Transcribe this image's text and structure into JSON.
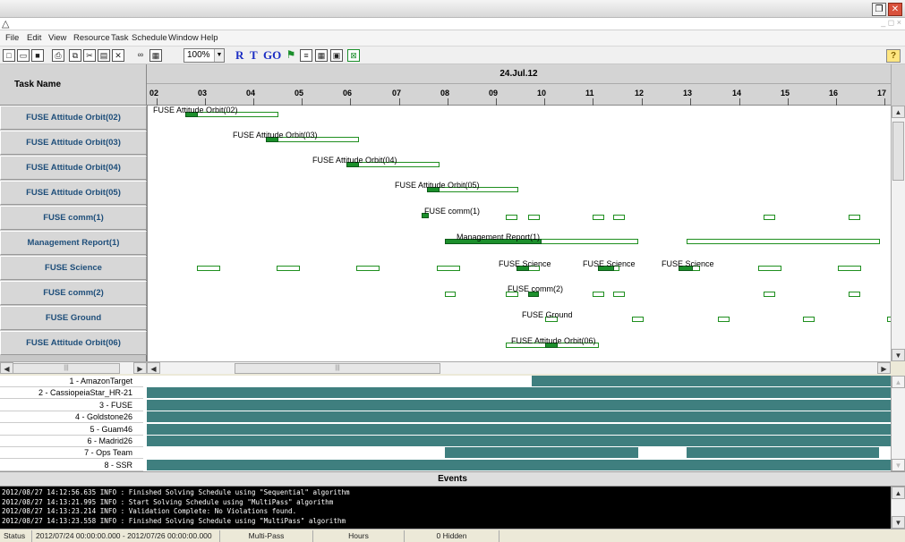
{
  "window": {
    "restore_glyph": "❐",
    "close_glyph": "✕"
  },
  "mdi": {
    "icon_glyph": "△",
    "controls": "_ ◻ ×"
  },
  "menu": [
    "File",
    "Edit",
    "View",
    "Resource",
    "Task",
    "Schedule",
    "Window",
    "Help"
  ],
  "toolbar": {
    "zoom": "100%",
    "zoom_arrow": "▼",
    "r": "R",
    "t": "T",
    "go": "GO",
    "help": "?"
  },
  "grid": {
    "name_header": "Task Name",
    "date": "24.Jul.12",
    "hours": [
      "02",
      "03",
      "04",
      "05",
      "06",
      "07",
      "08",
      "09",
      "10",
      "11",
      "12",
      "13",
      "14",
      "15",
      "16",
      "17"
    ]
  },
  "tasks": [
    "FUSE Attitude Orbit(02)",
    "FUSE Attitude Orbit(03)",
    "FUSE Attitude Orbit(04)",
    "FUSE Attitude Orbit(05)",
    "FUSE comm(1)",
    "Management Report(1)",
    "FUSE Science",
    "FUSE comm(2)",
    "FUSE Ground",
    "FUSE Attitude Orbit(06)"
  ],
  "gantt_labels": {
    "ao02": "FUSE Attitude Orbit(02)",
    "ao03": "FUSE Attitude Orbit(03)",
    "ao04": "FUSE Attitude Orbit(04)",
    "ao05": "FUSE Attitude Orbit(05)",
    "comm1": "FUSE comm(1)",
    "mgmt": "Management Report(1)",
    "sci1": "FUSE Science",
    "sci2": "FUSE Science",
    "sci3": "FUSE Science",
    "comm2": "FUSE comm(2)",
    "ground": "FUSE Ground",
    "ao06": "FUSE Attitude Orbit(06)"
  },
  "resources": [
    "1 - AmazonTarget",
    "2 - CassiopeiaStar_HR-21",
    "3 - FUSE",
    "4 - Goldstone26",
    "5 - Guam46",
    "6 - Madrid26",
    "7 - Ops Team",
    "8 - SSR"
  ],
  "events_header": "Events",
  "events": [
    "2012/08/27 14:12:56.635 INFO : Finished Solving Schedule using \"Sequential\" algorithm",
    "2012/08/27 14:13:21.995 INFO : Start Solving Schedule using \"MultiPass\" algorithm",
    "2012/08/27 14:13:23.214 INFO : Validation Complete: No Violations found.",
    "2012/08/27 14:13:23.558 INFO : Finished Solving Schedule using \"MultiPass\" algorithm"
  ],
  "status": {
    "label": "Status",
    "range": "2012/07/24 00:00:00.000 - 2012/07/26 00:00:00.000",
    "algorithm": "Multi-Pass",
    "units": "Hours",
    "hidden": "0 Hidden"
  },
  "scroll": {
    "up": "▲",
    "down": "▼",
    "left": "◀",
    "right": "▶",
    "grip": "|||"
  },
  "colors": {
    "bar_fill": "#1c8f2c",
    "bar_border": "#1f8f1f",
    "resource_busy": "#3f7f7f",
    "task_text": "#1e4e7a"
  }
}
